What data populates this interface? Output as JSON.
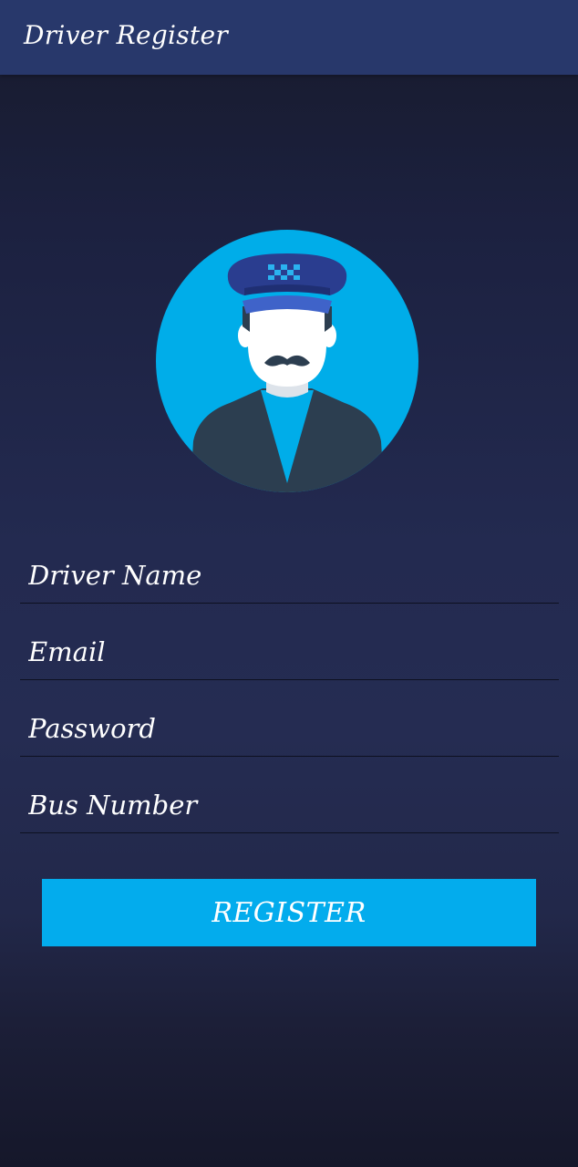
{
  "appbar": {
    "title": "Driver Register"
  },
  "avatar": {
    "icon": "driver-avatar-icon"
  },
  "form": {
    "driver_name_placeholder": "Driver Name",
    "email_placeholder": "Email",
    "password_placeholder": "Password",
    "bus_number_placeholder": "Bus Number"
  },
  "register_button": {
    "label": "REGISTER"
  },
  "colors": {
    "appbar": "#28386b",
    "background": "#232a50",
    "accent": "#03aced",
    "avatar_circle": "#00ade9",
    "jacket": "#2c3e50"
  }
}
